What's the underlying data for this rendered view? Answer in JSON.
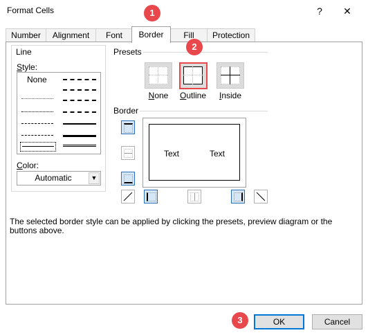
{
  "window": {
    "title": "Format Cells",
    "help_glyph": "?",
    "close_glyph": "✕"
  },
  "tabs": [
    {
      "label": "Number"
    },
    {
      "label": "Alignment"
    },
    {
      "label": "Font"
    },
    {
      "label": "Border",
      "active": true
    },
    {
      "label": "Fill"
    },
    {
      "label": "Protection"
    }
  ],
  "line_group": {
    "heading": "Line",
    "style_label": "Style:",
    "none_label": "None",
    "color_label": "Color:",
    "color_value": "Automatic"
  },
  "presets": {
    "heading": "Presets",
    "items": [
      {
        "label": "None"
      },
      {
        "label": "Outline",
        "highlighted": true
      },
      {
        "label": "Inside"
      }
    ]
  },
  "border_group": {
    "heading": "Border",
    "preview_text_left": "Text",
    "preview_text_right": "Text"
  },
  "help_text": "The selected border style can be applied by clicking the presets, preview diagram or the buttons above.",
  "buttons": {
    "ok": "OK",
    "cancel": "Cancel"
  },
  "annotations": [
    "1",
    "2",
    "3"
  ],
  "colors": {
    "annotation_red": "#e8474c",
    "selected_blue": "#2c6fb5",
    "ok_focus_blue": "#0078d7"
  }
}
